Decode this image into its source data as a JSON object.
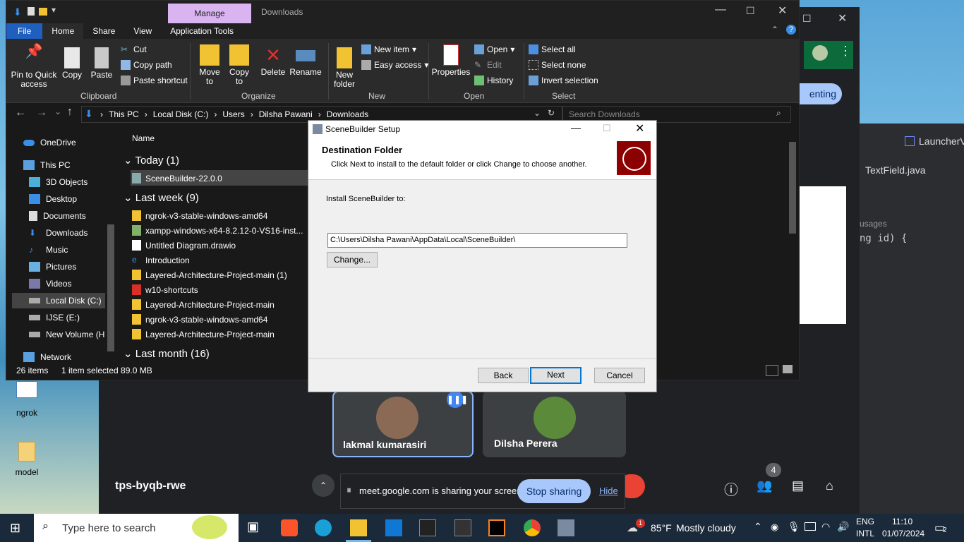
{
  "explorer": {
    "title": "Downloads",
    "manage_tab": "Manage",
    "tabs": [
      "File",
      "Home",
      "Share",
      "View",
      "Application Tools"
    ],
    "ribbon": {
      "clipboard": {
        "pin": "Pin to Quick access",
        "copy": "Copy",
        "paste": "Paste",
        "cut": "Cut",
        "copy_path": "Copy path",
        "paste_shortcut": "Paste shortcut",
        "label": "Clipboard"
      },
      "organize": {
        "move_to": "Move to",
        "copy_to": "Copy to",
        "delete": "Delete",
        "rename": "Rename",
        "label": "Organize"
      },
      "new": {
        "new_folder": "New folder",
        "new_item": "New item",
        "easy_access": "Easy access",
        "label": "New"
      },
      "open": {
        "properties": "Properties",
        "open": "Open",
        "edit": "Edit",
        "history": "History",
        "label": "Open"
      },
      "select": {
        "select_all": "Select all",
        "select_none": "Select none",
        "invert": "Invert selection",
        "label": "Select"
      }
    },
    "breadcrumb": [
      "This PC",
      "Local Disk (C:)",
      "Users",
      "Dilsha Pawani",
      "Downloads"
    ],
    "search_placeholder": "Search Downloads",
    "nav": [
      "OneDrive",
      "This PC",
      "3D Objects",
      "Desktop",
      "Documents",
      "Downloads",
      "Music",
      "Pictures",
      "Videos",
      "Local Disk (C:)",
      "IJSE (E:)",
      "New Volume (H:",
      "Network"
    ],
    "column_name": "Name",
    "groups": {
      "today": "Today (1)",
      "last_week": "Last week (9)",
      "last_month": "Last month (16)"
    },
    "today_files": [
      "SceneBuilder-22.0.0"
    ],
    "week_files": [
      "ngrok-v3-stable-windows-amd64",
      "xampp-windows-x64-8.2.12-0-VS16-inst...",
      "Untitled Diagram.drawio",
      "Introduction",
      "Layered-Architecture-Project-main (1)",
      "w10-shortcuts",
      "Layered-Architecture-Project-main",
      "ngrok-v3-stable-windows-amd64",
      "Layered-Architecture-Project-main"
    ],
    "status": {
      "items": "26 items",
      "selected": "1 item selected  89.0 MB"
    }
  },
  "dialog": {
    "title": "SceneBuilder Setup",
    "heading": "Destination Folder",
    "subheading": "Click Next to install to the default folder or click Change to choose another.",
    "install_label": "Install SceneBuilder to:",
    "path": "C:\\Users\\Dilsha Pawani\\AppData\\Local\\SceneBuilder\\",
    "change": "Change...",
    "back": "Back",
    "next": "Next",
    "cancel": "Cancel"
  },
  "meet": {
    "participants": [
      "lakmal kumarasiri",
      "Dilsha Perera"
    ],
    "code": "tps-byqb-rwe",
    "presenting": "enting",
    "people_count": "4",
    "share_text": "meet.google.com is sharing your screen.",
    "stop_sharing": "Stop sharing",
    "hide": "Hide"
  },
  "ide": {
    "tab1": "LauncherV",
    "tab2": "TextField.java",
    "usages": "usages",
    "code": "ng id) {"
  },
  "desktop": {
    "icon1": "ngrok",
    "icon2": "model"
  },
  "taskbar": {
    "search_placeholder": "Type here to search",
    "weather_temp": "85°F",
    "weather_desc": "Mostly cloudy",
    "lang1": "ENG",
    "lang2": "INTL",
    "time": "11:10",
    "date": "01/07/2024",
    "notif_count": "2",
    "weather_badge": "1"
  }
}
